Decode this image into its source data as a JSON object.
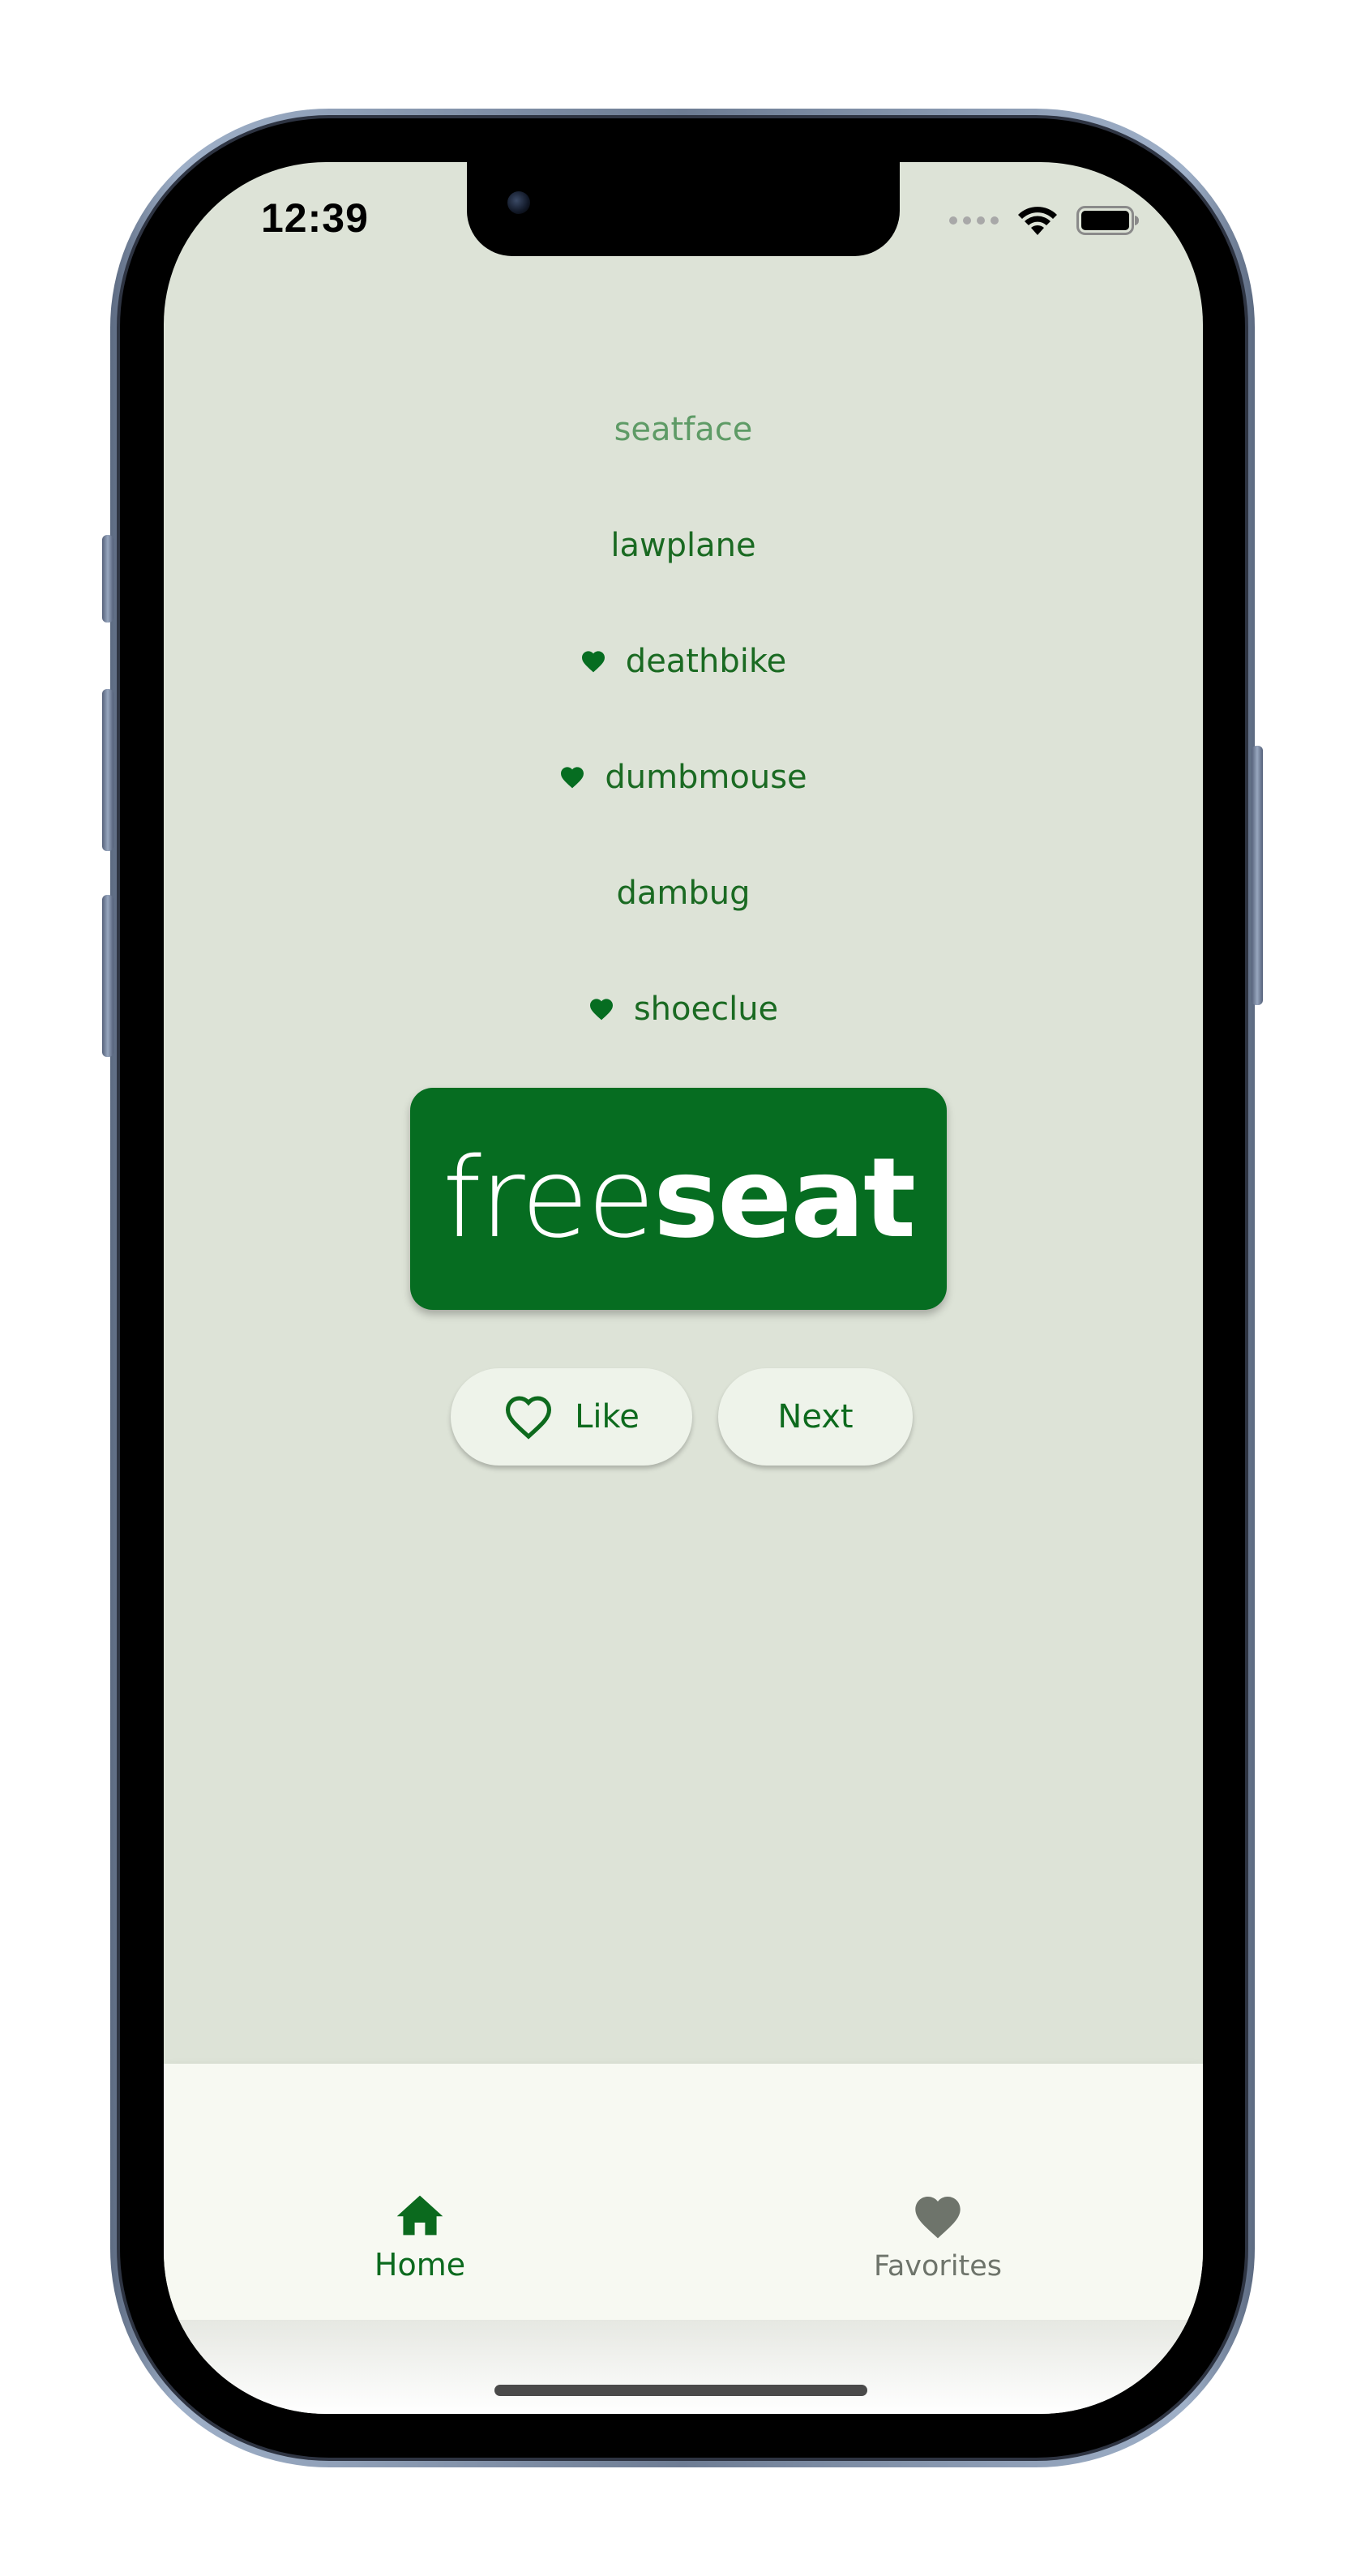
{
  "status_bar": {
    "time": "12:39",
    "icons": [
      "signal-dots-icon",
      "wifi-icon",
      "battery-icon"
    ]
  },
  "word_list": {
    "items": [
      {
        "label": "seatface",
        "favorited": false,
        "muted": true
      },
      {
        "label": "lawplane",
        "favorited": false,
        "muted": false
      },
      {
        "label": "deathbike",
        "favorited": true,
        "muted": false
      },
      {
        "label": "dumbmouse",
        "favorited": true,
        "muted": false
      },
      {
        "label": "dambug",
        "favorited": false,
        "muted": false
      },
      {
        "label": "shoeclue",
        "favorited": true,
        "muted": false
      }
    ]
  },
  "current_pair": {
    "first": "free",
    "second": "seat"
  },
  "actions": {
    "like_label": "Like",
    "next_label": "Next"
  },
  "navigation": {
    "home_label": "Home",
    "favorites_label": "Favorites",
    "selected": "home"
  },
  "colors": {
    "primary": "#066d21",
    "background": "#dde3d7",
    "button_bg": "#eef3ea",
    "nav_bg": "#f7f9f2",
    "muted_text": "#5e9b66",
    "inactive_nav": "#6e746b"
  }
}
